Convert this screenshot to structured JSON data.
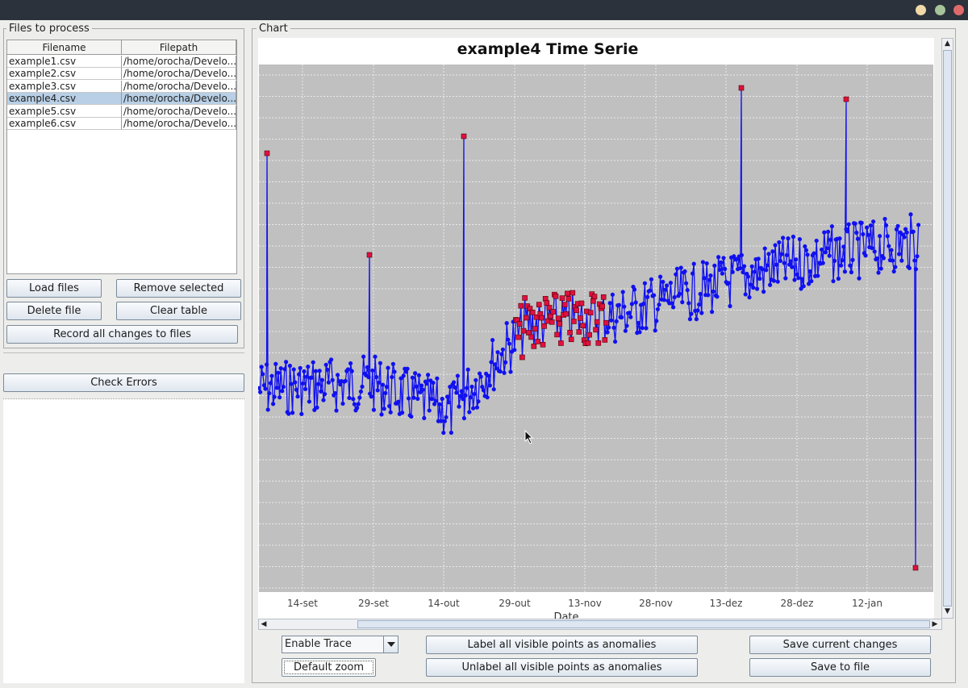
{
  "files_panel": {
    "title": "Files to process",
    "columns": [
      "Filename",
      "Filepath"
    ],
    "rows": [
      {
        "filename": "example1.csv",
        "filepath": "/home/orocha/Develo..."
      },
      {
        "filename": "example2.csv",
        "filepath": "/home/orocha/Develo..."
      },
      {
        "filename": "example3.csv",
        "filepath": "/home/orocha/Develo..."
      },
      {
        "filename": "example4.csv",
        "filepath": "/home/orocha/Develo..."
      },
      {
        "filename": "example5.csv",
        "filepath": "/home/orocha/Develo..."
      },
      {
        "filename": "example6.csv",
        "filepath": "/home/orocha/Develo..."
      }
    ],
    "selected_row": 3,
    "buttons": {
      "load": "Load files",
      "remove": "Remove selected",
      "delete": "Delete file",
      "clear": "Clear table",
      "record": "Record all changes to files"
    }
  },
  "check_errors_label": "Check Errors",
  "chart_panel": {
    "title": "Chart"
  },
  "chart_data": {
    "type": "line",
    "title": "example4 Time Serie",
    "xlabel": "Date",
    "ylabel": "",
    "x_ticks": [
      "14-set",
      "29-set",
      "14-out",
      "29-out",
      "13-nov",
      "28-nov",
      "13-dez",
      "28-dez",
      "12-jan"
    ],
    "series_color": "#1010f0",
    "anomaly_color": "#e01040",
    "background": "#c0c0c0",
    "grid": true
  },
  "controls": {
    "trace_select": "Enable Trace",
    "default_zoom": "Default zoom",
    "label_all": "Label all visible points as anomalies",
    "unlabel_all": "Unlabel all visible points as anomalies",
    "save_changes": "Save current changes",
    "save_file": "Save to file"
  }
}
